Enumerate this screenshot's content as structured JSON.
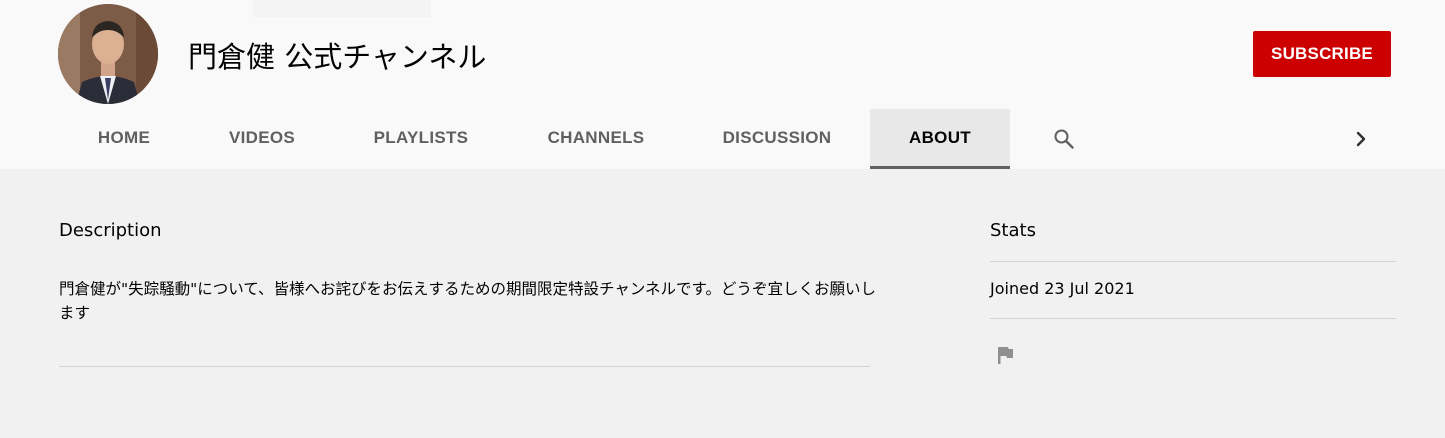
{
  "channel": {
    "name": "門倉健 公式チャンネル",
    "subscribe_label": "SUBSCRIBE"
  },
  "tabs": [
    {
      "label": "HOME"
    },
    {
      "label": "VIDEOS"
    },
    {
      "label": "PLAYLISTS"
    },
    {
      "label": "CHANNELS"
    },
    {
      "label": "DISCUSSION"
    },
    {
      "label": "ABOUT",
      "active": true
    }
  ],
  "icons": {
    "search": "search-icon",
    "next": "chevron-right-icon",
    "flag": "flag-icon"
  },
  "about": {
    "description_heading": "Description",
    "description_text": "門倉健が\"失踪騒動\"について、皆様へお詫びをお伝えするための期間限定特設チャンネルです。どうぞ宜しくお願いします",
    "stats_heading": "Stats",
    "joined_label": "Joined",
    "joined_date": "23 Jul 2021"
  },
  "colors": {
    "subscribe": "#cc0000",
    "header_bg": "#f9f9f9",
    "page_bg": "#f1f1f1",
    "active_tab_bg": "#e8e8e8"
  }
}
